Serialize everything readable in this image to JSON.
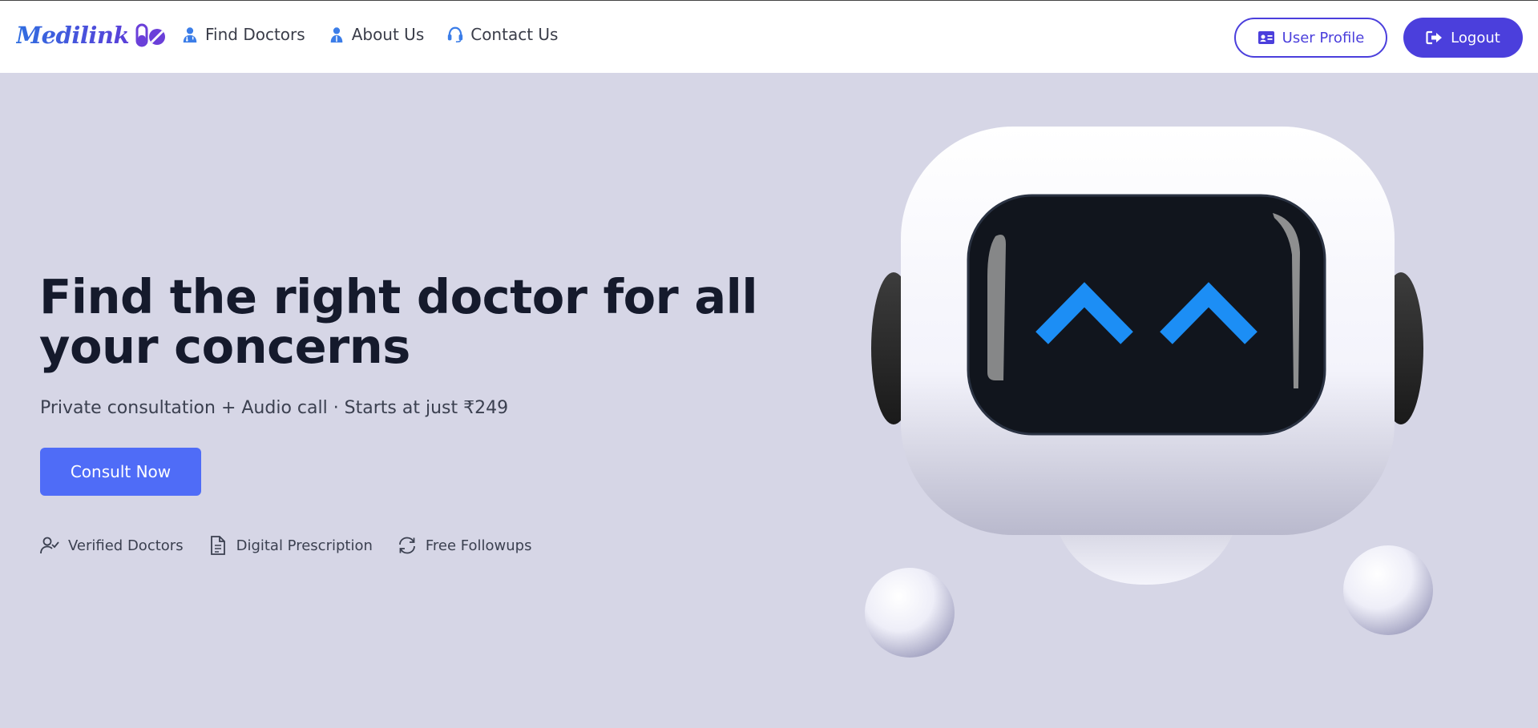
{
  "brand": {
    "name": "Medilink",
    "icon": "pills-icon",
    "color_start": "#2f6ee0",
    "color_end": "#5a3fd9"
  },
  "nav": {
    "links": [
      {
        "label": "Find Doctors",
        "icon": "doctor-icon"
      },
      {
        "label": "About Us",
        "icon": "person-icon"
      },
      {
        "label": "Contact Us",
        "icon": "headset-icon"
      }
    ],
    "profile_label": "User Profile",
    "profile_icon": "id-card-icon",
    "logout_label": "Logout",
    "logout_icon": "logout-icon"
  },
  "hero": {
    "title": "Find the right doctor for all your concerns",
    "subtitle": "Private consultation + Audio call · Starts at just ₹249",
    "cta_label": "Consult Now",
    "features": [
      {
        "label": "Verified Doctors",
        "icon": "user-check-icon"
      },
      {
        "label": "Digital Prescription",
        "icon": "document-icon"
      },
      {
        "label": "Free Followups",
        "icon": "refresh-icon"
      }
    ],
    "illustration": "robot-illustration"
  },
  "colors": {
    "accent": "#4b3fdc",
    "cta": "#4f6cf7",
    "background": "#d6d6e6",
    "robot_eyes": "#1c8ef5"
  }
}
